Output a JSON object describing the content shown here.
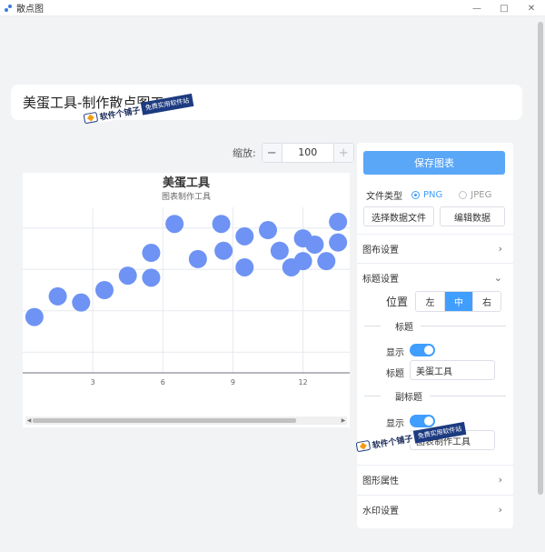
{
  "window": {
    "title": "散点图"
  },
  "header": {
    "title": "美蛋工具-制作散点图工"
  },
  "zoom": {
    "label": "缩放:",
    "value": "100",
    "minus": "−",
    "plus": "+"
  },
  "chart_data": {
    "type": "scatter",
    "title": "美蛋工具",
    "subtitle": "图表制作工具",
    "x_ticks": [
      "3",
      "6",
      "9",
      "12"
    ],
    "xlim": [
      0,
      14
    ],
    "ylim": [
      0,
      8
    ],
    "point_color": "#6e93f4",
    "points": [
      {
        "x": 0.5,
        "y": 2.7
      },
      {
        "x": 1.5,
        "y": 3.7
      },
      {
        "x": 2.5,
        "y": 3.4
      },
      {
        "x": 3.5,
        "y": 4.0
      },
      {
        "x": 4.5,
        "y": 4.7
      },
      {
        "x": 5.5,
        "y": 5.8
      },
      {
        "x": 5.5,
        "y": 4.6
      },
      {
        "x": 6.5,
        "y": 7.2
      },
      {
        "x": 7.5,
        "y": 5.5
      },
      {
        "x": 8.5,
        "y": 7.2
      },
      {
        "x": 8.6,
        "y": 5.9
      },
      {
        "x": 9.5,
        "y": 6.6
      },
      {
        "x": 9.5,
        "y": 5.1
      },
      {
        "x": 10.5,
        "y": 6.9
      },
      {
        "x": 11.0,
        "y": 5.9
      },
      {
        "x": 11.5,
        "y": 5.1
      },
      {
        "x": 12.0,
        "y": 6.5
      },
      {
        "x": 12.0,
        "y": 5.4
      },
      {
        "x": 12.5,
        "y": 6.2
      },
      {
        "x": 13.0,
        "y": 5.4
      },
      {
        "x": 13.5,
        "y": 7.3
      },
      {
        "x": 13.5,
        "y": 6.3
      }
    ]
  },
  "panel": {
    "save_label": "保存图表",
    "filetype_label": "文件类型",
    "filetype_options": [
      "PNG",
      "JPEG"
    ],
    "filetype_selected": "PNG",
    "select_data_label": "选择数据文件",
    "edit_data_label": "编辑数据",
    "sections": {
      "chart_settings": "图布设置",
      "title_settings": "标题设置",
      "shape_props": "图形属性",
      "watermark_settings": "水印设置"
    },
    "position_label": "位置",
    "position_options": [
      "左",
      "中",
      "右"
    ],
    "position_selected": "中",
    "title_group": "标题",
    "show_label": "显示",
    "title_field_label": "标题",
    "title_value": "美蛋工具",
    "subtitle_group": "副标题",
    "subtitle_show_label": "显示",
    "subtitle_value": "图表制作工具"
  },
  "watermark": {
    "brand": "软件个铺子",
    "tag": "免费实用软件站"
  },
  "colors": {
    "accent": "#409eff",
    "save_button": "#5aa6f7",
    "point": "#6e93f4"
  }
}
